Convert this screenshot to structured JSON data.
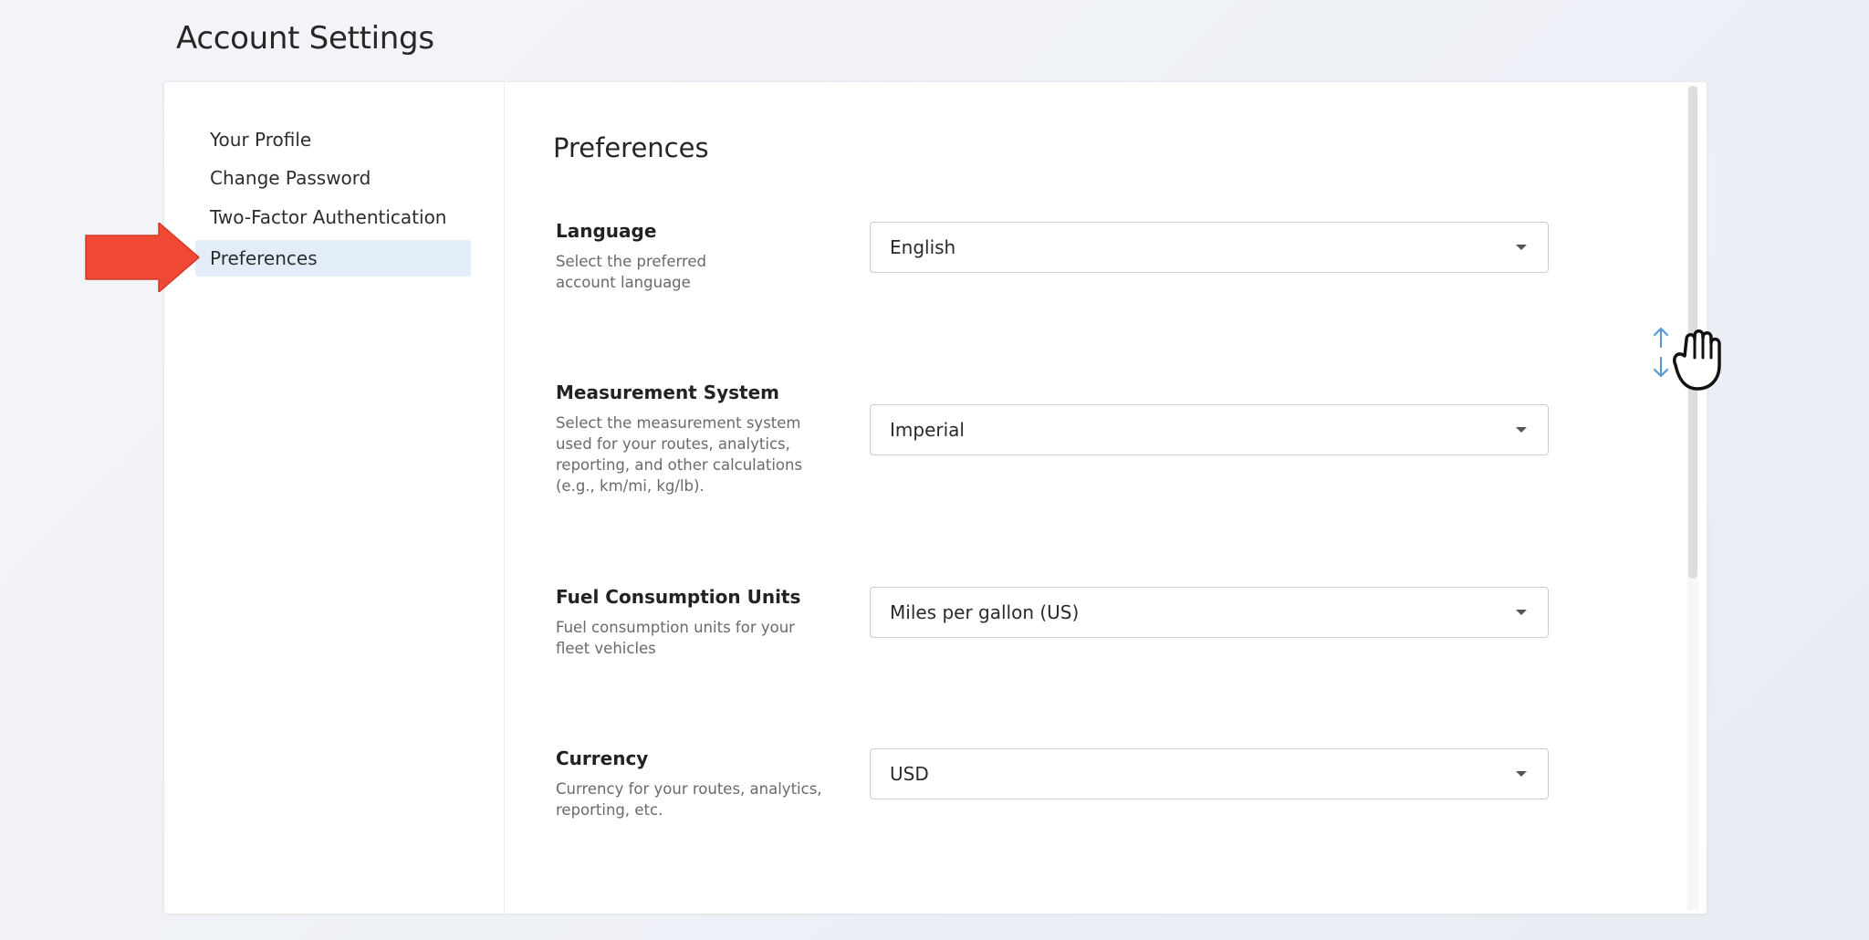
{
  "page": {
    "title": "Account Settings"
  },
  "sidebar": {
    "items": [
      {
        "label": "Your Profile",
        "active": false
      },
      {
        "label": "Change Password",
        "active": false
      },
      {
        "label": "Two-Factor Authentication",
        "active": false
      },
      {
        "label": "Preferences",
        "active": true
      }
    ]
  },
  "main": {
    "title": "Preferences",
    "preferences": [
      {
        "label": "Language",
        "description": "Select the preferred account language",
        "value": "English"
      },
      {
        "label": "Measurement System",
        "description": "Select the measurement system used for your routes, analytics, reporting, and other calculations (e.g., km/mi, kg/lb).",
        "value": "Imperial"
      },
      {
        "label": "Fuel Consumption Units",
        "description": "Fuel consumption units for your fleet vehicles",
        "value": "Miles per gallon (US)"
      },
      {
        "label": "Currency",
        "description": "Currency for your routes, analytics, reporting, etc.",
        "value": "USD"
      }
    ]
  },
  "colors": {
    "active_nav_bg": "#e3edf9",
    "arrow_indicator": "#f04a36",
    "scroll_hint_arrows": "#5b9bd5"
  },
  "icons": {
    "pointer_arrow": "red-arrow-icon",
    "scroll_cursor": "grab-hand-icon",
    "scroll_hint": "up-down-arrows-icon"
  }
}
